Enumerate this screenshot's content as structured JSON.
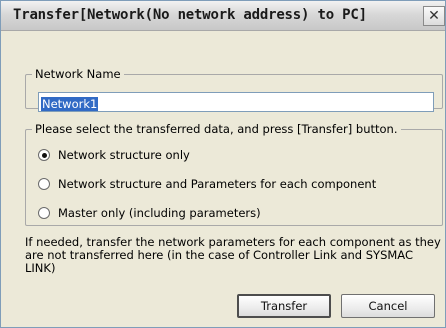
{
  "window": {
    "title": "Transfer[Network(No network address) to PC]"
  },
  "network_name": {
    "label": "Network Name",
    "value": "Network1"
  },
  "transfer_data": {
    "label": "Please select the transferred data, and press [Transfer] button.",
    "options": [
      {
        "label": "Network structure only",
        "selected": true
      },
      {
        "label": "Network structure and Parameters for each component",
        "selected": false
      },
      {
        "label": "Master only (including parameters)",
        "selected": false
      }
    ]
  },
  "note": "If needed, transfer the network parameters for each component as they are not transferred here (in the case of Controller Link and SYSMAC LINK)",
  "buttons": {
    "transfer": "Transfer",
    "cancel": "Cancel"
  },
  "icons": {
    "close": "close-icon"
  },
  "colors": {
    "dialog_bg": "#ece9d8",
    "selection": "#316ac5"
  }
}
